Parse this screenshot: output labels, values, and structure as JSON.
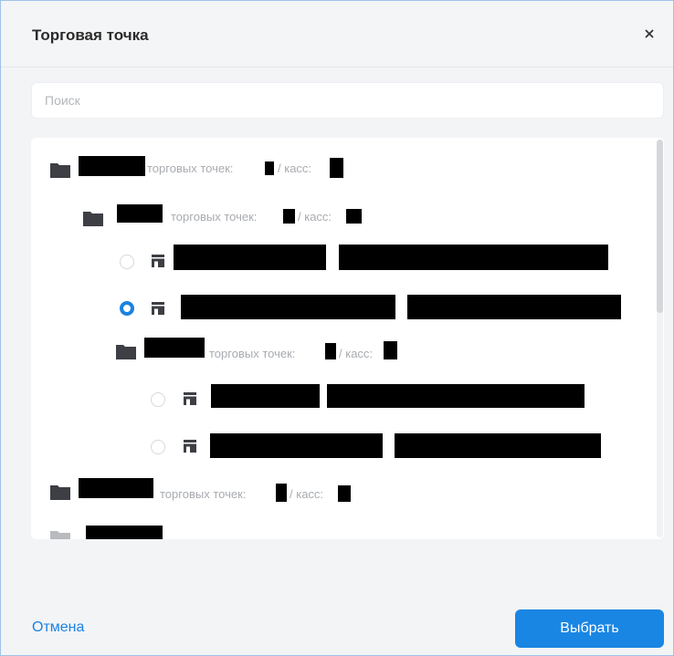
{
  "dialog": {
    "title": "Торговая точка",
    "close_symbol": "×"
  },
  "search": {
    "placeholder": "Поиск",
    "value": ""
  },
  "tree": {
    "nodes": [
      {
        "type": "folder",
        "meta": "торговых точек:",
        "meta_sep": "/ касс:"
      },
      {
        "type": "folder",
        "meta": "торговых точек:",
        "meta_sep": "/ касс:"
      },
      {
        "type": "store",
        "selected": false
      },
      {
        "type": "store",
        "selected": true
      },
      {
        "type": "folder",
        "meta": "торговых точек:",
        "meta_sep": "/ касс:"
      },
      {
        "type": "store",
        "selected": false
      },
      {
        "type": "store",
        "selected": false
      },
      {
        "type": "folder",
        "meta": "торговых точек:",
        "meta_sep": "/ касс:"
      },
      {
        "type": "folder"
      }
    ]
  },
  "footer": {
    "cancel_label": "Отмена",
    "choose_label": "Выбрать"
  },
  "colors": {
    "accent": "#1a86e4",
    "folder": "#3d3f45",
    "folder_faded": "#b9bbbf",
    "meta_text": "#a8abb0"
  },
  "icons": {
    "close": "close-icon",
    "folder": "folder-icon",
    "store": "store-icon"
  }
}
